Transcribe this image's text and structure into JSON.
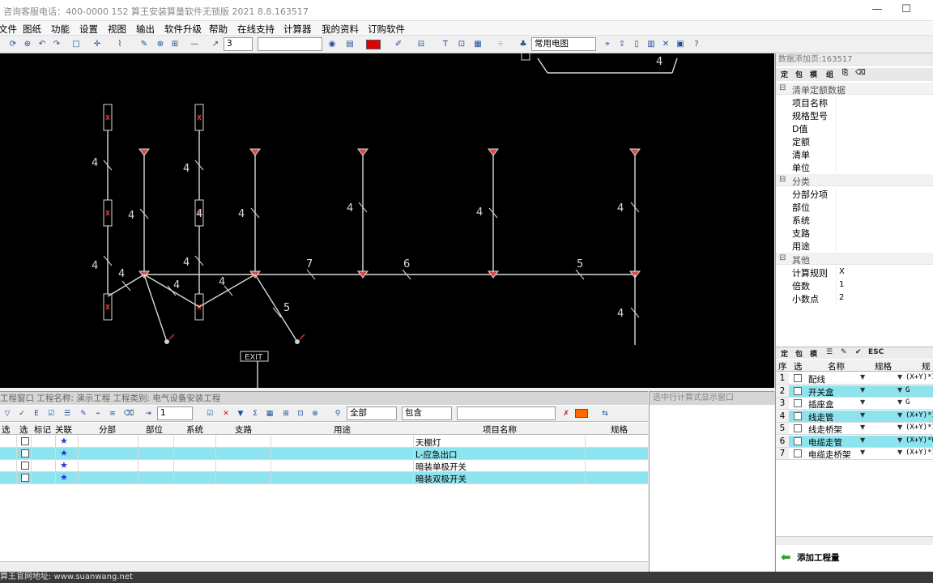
{
  "window": {
    "title": "咨询客服电话：400-0000 152  算王安装算量软件无锁版 2021 8.8.163517",
    "minimize": "—",
    "maximize": "☐"
  },
  "menu": [
    "文件",
    "图纸",
    "功能",
    "设置",
    "视图",
    "输出",
    "软件升级",
    "帮助",
    "在线支持",
    "计算器",
    "我的资料",
    "订购软件"
  ],
  "toolbar": {
    "line_width": "3",
    "layer_select": "常用电图",
    "accent_color": "#e00000"
  },
  "cad": {
    "background": "#000000",
    "wire_labels": [
      "4",
      "4",
      "4",
      "4",
      "4",
      "4",
      "4",
      "4",
      "4",
      "4",
      "4",
      "4",
      "4",
      "4",
      "7",
      "6",
      "5",
      "5",
      "4",
      "4"
    ],
    "exit_label": "EXIT",
    "lamp_color": "#d84a4a"
  },
  "right_panel": {
    "title": "数据添加页:163517",
    "tools": [
      "定",
      "包",
      "模",
      "组"
    ],
    "sections": [
      {
        "title": "清单定额数据",
        "rows": [
          {
            "label": "项目名称",
            "value": ""
          },
          {
            "label": "规格型号",
            "value": ""
          },
          {
            "label": "D值",
            "value": ""
          },
          {
            "label": "定额",
            "value": ""
          },
          {
            "label": "清单",
            "value": ""
          },
          {
            "label": "单位",
            "value": ""
          }
        ]
      },
      {
        "title": "分类",
        "rows": [
          {
            "label": "分部分项",
            "value": ""
          },
          {
            "label": "部位",
            "value": ""
          },
          {
            "label": "系统",
            "value": ""
          },
          {
            "label": "支路",
            "value": ""
          },
          {
            "label": "用途",
            "value": ""
          }
        ]
      },
      {
        "title": "其他",
        "rows": [
          {
            "label": "计算规则",
            "value": "X"
          },
          {
            "label": "倍数",
            "value": "1"
          },
          {
            "label": "小数点",
            "value": "2"
          }
        ]
      }
    ],
    "tools2": [
      "定",
      "包",
      "模",
      "ESC"
    ],
    "table": {
      "headers": [
        "序",
        "选",
        "名称",
        "规格",
        "规"
      ],
      "rows": [
        {
          "no": "1",
          "name": "配线",
          "formula": "(X+Y)*I",
          "highlight": false
        },
        {
          "no": "2",
          "name": "开关盒",
          "formula": "G",
          "highlight": true
        },
        {
          "no": "3",
          "name": "插座盒",
          "formula": "G",
          "highlight": false
        },
        {
          "no": "4",
          "name": "线走管",
          "formula": "(X+Y)*I",
          "highlight": true
        },
        {
          "no": "5",
          "name": "线走桥架",
          "formula": "(X+Y)*I",
          "highlight": false
        },
        {
          "no": "6",
          "name": "电缆走管",
          "formula": "(X+Y)*W",
          "highlight": true
        },
        {
          "no": "7",
          "name": "电缆走桥架",
          "formula": "(X+Y)*I",
          "highlight": false
        }
      ]
    },
    "add_button": "添加工程量"
  },
  "bottom_panel": {
    "title": "工程窗口 工程名称: 演示工程 工程类别: 电气设备安装工程",
    "page_input": "1",
    "filter_all": "全部",
    "filter_contains": "包含",
    "headers": [
      "序号",
      "选",
      "标记",
      "关联",
      "分部",
      "部位",
      "系统",
      "支路",
      "用途",
      "项目名称",
      "规格"
    ],
    "rows": [
      {
        "name": "天棚灯",
        "highlight": false
      },
      {
        "name": "L-应急出口",
        "highlight": true
      },
      {
        "name": "暗装单极开关",
        "highlight": false
      },
      {
        "name": "暗装双极开关",
        "highlight": true
      }
    ]
  },
  "middle_panel": {
    "title": "选中行计算式显示窗口"
  },
  "status": {
    "text": "算王官网地址: www.suanwang.net"
  }
}
